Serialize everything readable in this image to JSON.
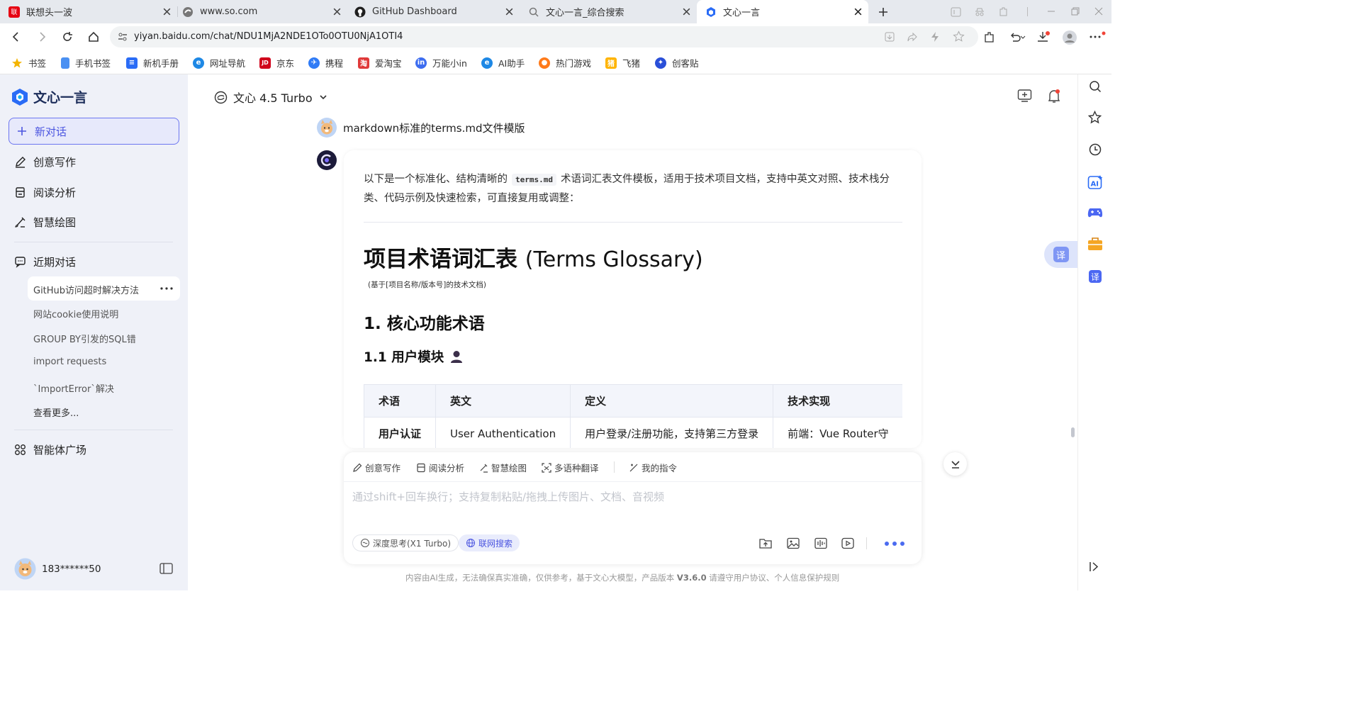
{
  "tabs": [
    {
      "title": "联想头一波",
      "icon": "lenovo-icon",
      "color": "#e60012"
    },
    {
      "title": "www.so.com",
      "icon": "so-icon",
      "color": "#666"
    },
    {
      "title": "GitHub Dashboard",
      "icon": "github-icon",
      "color": "#1f1f1f"
    },
    {
      "title": "文心一言_综合搜索",
      "icon": "search-icon",
      "color": "#777"
    },
    {
      "title": "文心一言",
      "icon": "wenxin-icon",
      "color": "#2a6cf6"
    }
  ],
  "address": {
    "url": "yiyan.baidu.com/chat/NDU1MjA2NDE1OTo0OTU0NjA1OTI4"
  },
  "bookmarks": [
    {
      "label": "书签",
      "icon": "star-icon",
      "color": "#f4b400"
    },
    {
      "label": "手机书签",
      "icon": "phone-bookmark-icon",
      "color": "#4a90f2"
    },
    {
      "label": "新机手册",
      "icon": "manual-icon",
      "color": "#2a6cf6"
    },
    {
      "label": "网址导航",
      "icon": "nav-icon",
      "color": "#1e88e5"
    },
    {
      "label": "京东",
      "icon": "jd-icon",
      "color": "#d0021b"
    },
    {
      "label": "携程",
      "icon": "ctrip-icon",
      "color": "#2f7bf6"
    },
    {
      "label": "爱淘宝",
      "icon": "taobao-icon",
      "color": "#e03a3a"
    },
    {
      "label": "万能小in",
      "icon": "xiaoin-icon",
      "color": "#3d6df0"
    },
    {
      "label": "AI助手",
      "icon": "ai-assistant-icon",
      "color": "#1e88e5"
    },
    {
      "label": "热门游戏",
      "icon": "game-icon",
      "color": "#ff7a1a"
    },
    {
      "label": "飞猪",
      "icon": "fliggy-icon",
      "color": "#ffb400"
    },
    {
      "label": "创客贴",
      "icon": "chuangkit-icon",
      "color": "#2a4fd8"
    }
  ],
  "sidebar": {
    "logo_text": "文心一言",
    "new_chat": "新对话",
    "nav": [
      "创意写作",
      "阅读分析",
      "智慧绘图"
    ],
    "recent_label": "近期对话",
    "history": [
      "GitHub访问超时解决方法",
      "网站cookie使用说明",
      "GROUP BY引发的SQL错",
      "import requests",
      "`ImportError`解决"
    ],
    "more": "查看更多...",
    "agents": "智能体广场",
    "username": "183******50"
  },
  "header": {
    "model": "文心 4.5 Turbo"
  },
  "chat": {
    "user_message": "markdown标准的terms.md文件模版",
    "intro_before": "以下是一个标准化、结构清晰的",
    "intro_code": "terms.md",
    "intro_after": "术语词汇表文件模板，适用于技术项目文档，支持中英文对照、技术栈分类、代码示例及快速检索，可直接复用或调整：",
    "h1_zh": "项目术语词汇表 ",
    "h1_en": "(Terms Glossary)",
    "subtitle": "(基于[项目名称/版本号]的技术文档)",
    "h2": "1. 核心功能术语",
    "h3": "1.1 用户模块",
    "table": {
      "headers": [
        "术语",
        "英文",
        "定义",
        "技术实现"
      ],
      "rows": [
        [
          "用户认证",
          "User Authentication",
          "用户登录/注册功能，支持第三方登录",
          "前端：Vue Router守"
        ]
      ]
    }
  },
  "input": {
    "tools": [
      "创意写作",
      "阅读分析",
      "智慧绘图",
      "多语种翻译",
      "我的指令"
    ],
    "placeholder": "通过shift+回车换行；支持复制粘贴/拖拽上传图片、文档、音视频",
    "deep_think": "深度思考(X1 Turbo)",
    "web_search": "联网搜索"
  },
  "translate_badge": "译",
  "footer": {
    "before": "内容由AI生成，无法确保真实准确，仅供参考，基于文心大模型，产品版本 ",
    "version": "V3.6.0",
    "after": " 请遵守用户协议、个人信息保护规则"
  }
}
